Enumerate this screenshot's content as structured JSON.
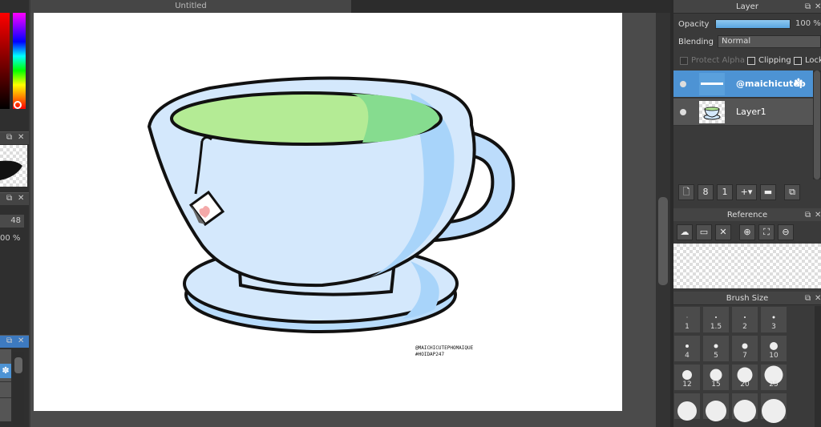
{
  "document_tab": {
    "title": "Untitled"
  },
  "left_panel": {
    "brush_size_value": "48",
    "opacity_value": "00 %"
  },
  "canvas": {
    "watermark": {
      "line1": "@MAICHICUTEPHOMAIQUE",
      "line2": "#HOIDAP247"
    }
  },
  "layer_panel": {
    "title": "Layer",
    "opacity_label": "Opacity",
    "opacity_value": "100 %",
    "opacity_level": 1.0,
    "blending_label": "Blending",
    "blending_value": "Normal",
    "protect_alpha": "Protect Alpha",
    "clipping": "Clipping",
    "lock": "Lock",
    "layers": [
      {
        "name": "@maichicutep",
        "active": true
      },
      {
        "name": "Layer1",
        "active": false
      }
    ],
    "toolbar_icons": [
      "new-layer-icon",
      "new-8bit-layer-icon",
      "new-1bit-layer-icon",
      "add-layer-menu-icon",
      "folder-icon",
      "duplicate-icon"
    ]
  },
  "reference_panel": {
    "title": "Reference",
    "toolbar_icons": [
      "cloud-icon",
      "open-folder-icon",
      "close-icon",
      "zoom-in-icon",
      "fit-icon",
      "zoom-out-icon"
    ]
  },
  "brush_size_panel": {
    "title": "Brush Size",
    "sizes": [
      "1",
      "1.5",
      "2",
      "3",
      "4",
      "5",
      "7",
      "10",
      "12",
      "15",
      "20",
      "25"
    ]
  },
  "colors": {
    "accent": "#4d93d4",
    "tea_light": "#b4eb95",
    "tea_dark": "#86dc8f",
    "cup": "#d4e8fc",
    "cup_shade": "#a8d4fa"
  }
}
